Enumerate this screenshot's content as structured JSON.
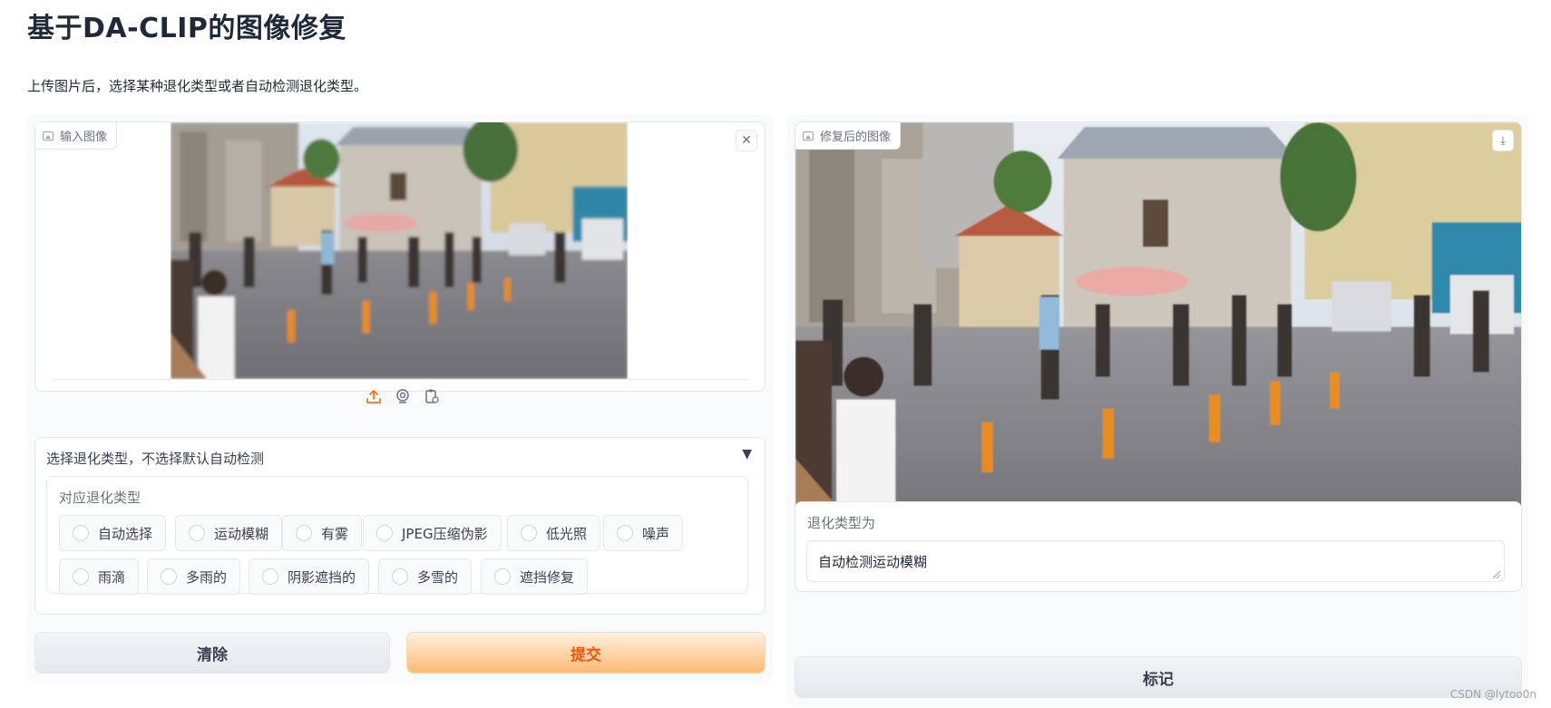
{
  "page": {
    "title": "基于DA-CLIP的图像修复",
    "description": "上传图片后，选择某种退化类型或者自动检测退化类型。"
  },
  "input_image": {
    "label": "输入图像",
    "close_glyph": "✕",
    "sources": [
      "upload-icon",
      "webcam-icon",
      "clipboard-icon"
    ]
  },
  "output_image": {
    "label": "修复后的图像",
    "download_glyph": "⤓"
  },
  "degradation": {
    "accordion_title": "选择退化类型，不选择默认自动检测",
    "accordion_arrow": "▼",
    "group_label": "对应退化类型",
    "options": [
      "自动选择",
      "运动模糊",
      "有雾",
      "JPEG压缩伪影",
      "低光照",
      "噪声",
      "雨滴",
      "多雨的",
      "阴影遮挡的",
      "多雪的",
      "遮挡修复"
    ],
    "selected": null
  },
  "buttons": {
    "clear": "清除",
    "submit": "提交",
    "flag": "标记"
  },
  "result": {
    "label": "退化类型为",
    "value": "自动检测运动模糊"
  },
  "watermark": "CSDN @lytoo0n",
  "colors": {
    "accent": "#ea580c",
    "primary_button": "#fdba74",
    "border": "#e5e7eb"
  }
}
